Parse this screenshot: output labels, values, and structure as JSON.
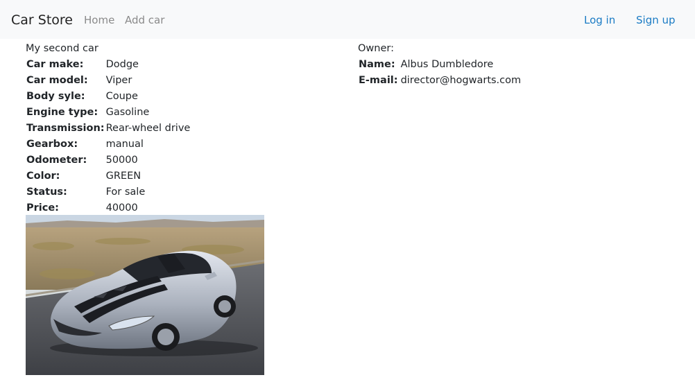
{
  "navbar": {
    "brand": "Car Store",
    "links": [
      "Home",
      "Add car"
    ],
    "login": "Log in",
    "signup": "Sign up"
  },
  "car": {
    "title": "My second car",
    "specs": [
      {
        "label": "Car make:",
        "value": "Dodge"
      },
      {
        "label": "Car model:",
        "value": "Viper"
      },
      {
        "label": "Body syle:",
        "value": "Coupe"
      },
      {
        "label": "Engine type:",
        "value": "Gasoline"
      },
      {
        "label": "Transmission:",
        "value": "Rear-wheel drive"
      },
      {
        "label": "Gearbox:",
        "value": "manual"
      },
      {
        "label": "Odometer:",
        "value": "50000"
      },
      {
        "label": "Color:",
        "value": "GREEN"
      },
      {
        "label": "Status:",
        "value": "For sale"
      },
      {
        "label": "Price:",
        "value": "40000"
      }
    ],
    "image_icon": "car-photo"
  },
  "owner": {
    "title": "Owner:",
    "name_label": "Name:",
    "name": "Albus Dumbledore",
    "email_label": "E-mail:",
    "email": "director@hogwarts.com"
  },
  "colors": {
    "navbar_bg": "#f8f9fa",
    "link_blue": "#1a7bc4",
    "link_gray": "#8a8a8a",
    "car_body": "#b9bec8",
    "car_stripe": "#1b1d22"
  }
}
